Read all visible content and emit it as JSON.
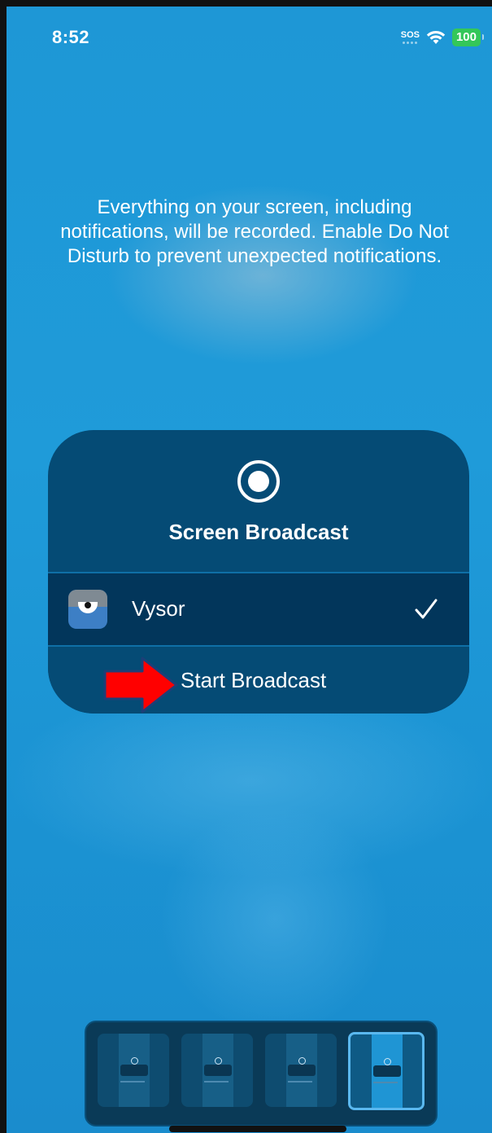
{
  "status_bar": {
    "time": "8:52",
    "sos": "SOS",
    "battery": "100"
  },
  "info_text": "Everything on your screen, including notifications, will be recorded. Enable Do Not Disturb to prevent unexpected notifications.",
  "broadcast_panel": {
    "title": "Screen Broadcast",
    "app_item": {
      "label": "Vysor",
      "selected": true
    },
    "start_button_label": "Start Broadcast"
  },
  "app_switcher": {
    "thumbnail_count": 4,
    "active_index": 3
  },
  "colors": {
    "background": "#1e97d6",
    "panel": "#054b75",
    "selected_row": "#02365b",
    "arrow": "#ff0000",
    "battery": "#34c759"
  }
}
